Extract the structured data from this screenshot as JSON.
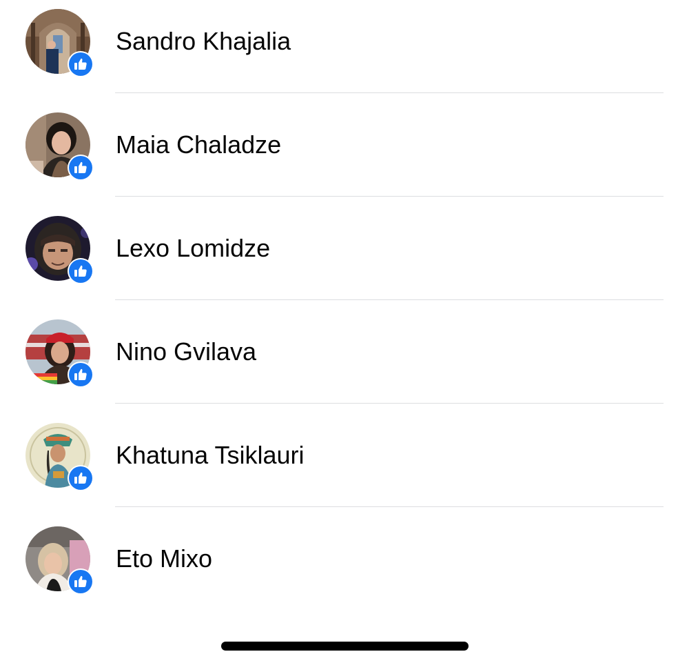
{
  "accent_color": "#1877f2",
  "people": [
    {
      "name": "Sandro Khajalia",
      "reaction": "like-icon"
    },
    {
      "name": "Maia Chaladze",
      "reaction": "like-icon"
    },
    {
      "name": "Lexo Lomidze",
      "reaction": "like-icon"
    },
    {
      "name": "Nino Gvilava",
      "reaction": "like-icon"
    },
    {
      "name": "Khatuna Tsiklauri",
      "reaction": "like-icon"
    },
    {
      "name": "Eto Mixo",
      "reaction": "like-icon"
    }
  ]
}
